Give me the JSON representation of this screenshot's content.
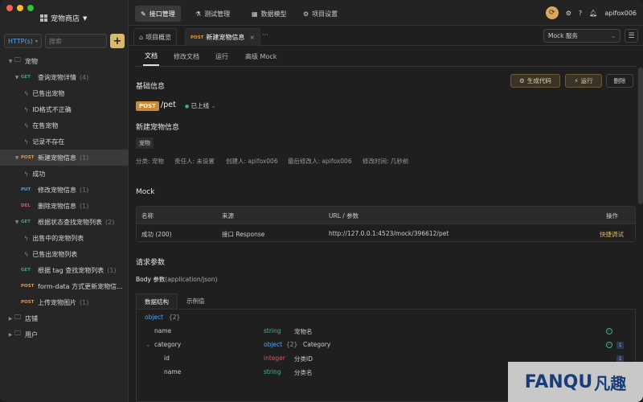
{
  "colors": {
    "accent": "#d8b96a",
    "get": "#2bb07f",
    "post": "#e79a3b",
    "put": "#4fa3f7",
    "del": "#e5534b"
  },
  "sidebar": {
    "project_name": "宠物商店",
    "method_select": "HTTP(s)",
    "search_placeholder": "搜索",
    "add_label": "+",
    "tree": [
      {
        "type": "folder",
        "label": "宠物",
        "level": 0
      },
      {
        "type": "api",
        "method": "GET",
        "label": "查询宠物详情",
        "count": "(4)",
        "level": 1
      },
      {
        "type": "case",
        "label": "已售出宠物",
        "level": 2
      },
      {
        "type": "case",
        "label": "ID格式不正确",
        "level": 2
      },
      {
        "type": "case",
        "label": "在售宠物",
        "level": 2
      },
      {
        "type": "case",
        "label": "记录不存在",
        "level": 2
      },
      {
        "type": "api",
        "method": "POST",
        "label": "新建宠物信息",
        "count": "(1)",
        "level": 1,
        "selected": true
      },
      {
        "type": "case",
        "label": "成功",
        "level": 2
      },
      {
        "type": "api",
        "method": "PUT",
        "label": "修改宠物信息",
        "count": "(1)",
        "level": 1
      },
      {
        "type": "api",
        "method": "DEL",
        "label": "删除宠物信息",
        "count": "(1)",
        "level": 1
      },
      {
        "type": "api",
        "method": "GET",
        "label": "根据状态查找宠物列表",
        "count": "(2)",
        "level": 1
      },
      {
        "type": "case",
        "label": "出售中的宠物列表",
        "level": 2
      },
      {
        "type": "case",
        "label": "已售出宠物列表",
        "level": 2
      },
      {
        "type": "api",
        "method": "GET",
        "label": "根据 tag 查找宠物列表",
        "count": "(1)",
        "level": 1
      },
      {
        "type": "api",
        "method": "POST",
        "label": "form-data 方式更新宠物信...",
        "count": "",
        "level": 1
      },
      {
        "type": "api",
        "method": "POST",
        "label": "上传宠物图片",
        "count": "(1)",
        "level": 1
      },
      {
        "type": "folder",
        "label": "店铺",
        "level": 0
      },
      {
        "type": "folder",
        "label": "用户",
        "level": 0
      }
    ]
  },
  "topnav": {
    "tabs": [
      "接口管理",
      "测试管理",
      "数据模型",
      "项目设置"
    ],
    "user": "apifox006"
  },
  "tabbar": {
    "overview": "项目概览",
    "active_method": "POST",
    "active_title": "新建宠物信息",
    "more": "···",
    "mock_select": "Mock 服务"
  },
  "subtabs": [
    "文档",
    "修改文档",
    "运行",
    "高级 Mock"
  ],
  "doc": {
    "section_basic": "基础信息",
    "btn_generate": "生成代码",
    "btn_run": "运行",
    "btn_delete": "删除",
    "method": "POST",
    "path": "/pet",
    "status": "已上线",
    "name": "新建宠物信息",
    "tag": "宠物",
    "meta": [
      "分类: 宠物",
      "责任人: 未设置",
      "创建人: apifox006",
      "最后修改人: apifox006",
      "修改时间: 几秒前"
    ],
    "mock_title": "Mock",
    "mock_headers": [
      "名称",
      "来源",
      "URL / 参数",
      "操作"
    ],
    "mock_row": [
      "成功 (200)",
      "接口 Response",
      "http://127.0.0.1:4523/mock/396612/pet",
      "快捷调试"
    ],
    "req_title": "请求参数",
    "body_label": "Body 参数",
    "body_type": "(application/json)",
    "param_tabs": [
      "数据结构",
      "示例值"
    ],
    "schema": [
      {
        "name": "object",
        "type": "{2}",
        "desc": "",
        "level": 0
      },
      {
        "name": "name",
        "type": "string",
        "desc": "宠物名",
        "level": 1,
        "check": true
      },
      {
        "name": "category",
        "type": "object",
        "extra": "{2}",
        "desc": "Category",
        "level": 1,
        "check": true,
        "num": "1"
      },
      {
        "name": "id",
        "type": "integer",
        "desc": "分类ID",
        "level": 2,
        "num": "1"
      },
      {
        "name": "name",
        "type": "string",
        "desc": "分类名",
        "level": 2
      }
    ]
  },
  "watermark": {
    "latin": "FANQU",
    "cn": "凡趣"
  }
}
